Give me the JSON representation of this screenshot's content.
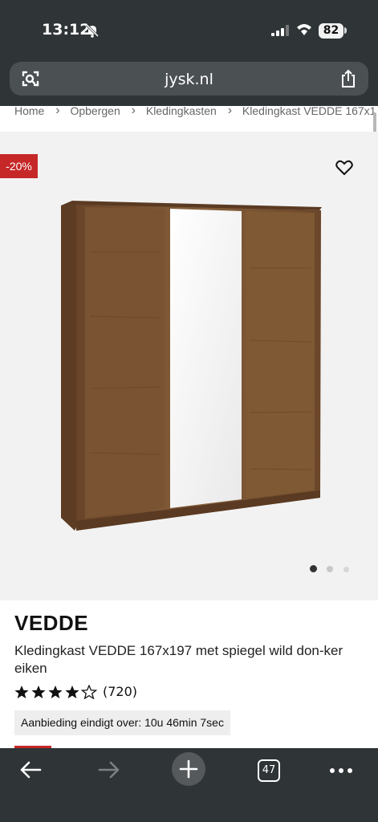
{
  "status_bar": {
    "time": "13:12",
    "battery": "82"
  },
  "browser": {
    "url": "jysk.nl",
    "tab_count": "47"
  },
  "breadcrumb": [
    "Home",
    "Opbergen",
    "Kledingkasten",
    "Kledingkast VEDDE 167x1"
  ],
  "product": {
    "badge": "-20%",
    "brand": "VEDDE",
    "title": "Kledingkast VEDDE 167x197 met spiegel wild don-ker eiken",
    "rating": 4,
    "rating_max": 5,
    "review_count": "(720)",
    "offer_text": "Aanbieding eindigt over: 10u 46min 7sec",
    "image_dots": 3,
    "active_dot": 0
  },
  "colors": {
    "browser_chrome": "#2f3437",
    "badge_red": "#c62828",
    "wood": "#7a5332"
  },
  "icons": [
    "bell-slash-icon",
    "signal-icon",
    "wifi-icon",
    "page-settings-icon",
    "share-icon",
    "heart-icon",
    "star-icon",
    "back-arrow-icon",
    "forward-arrow-icon",
    "plus-icon",
    "tabs-icon",
    "more-icon"
  ]
}
